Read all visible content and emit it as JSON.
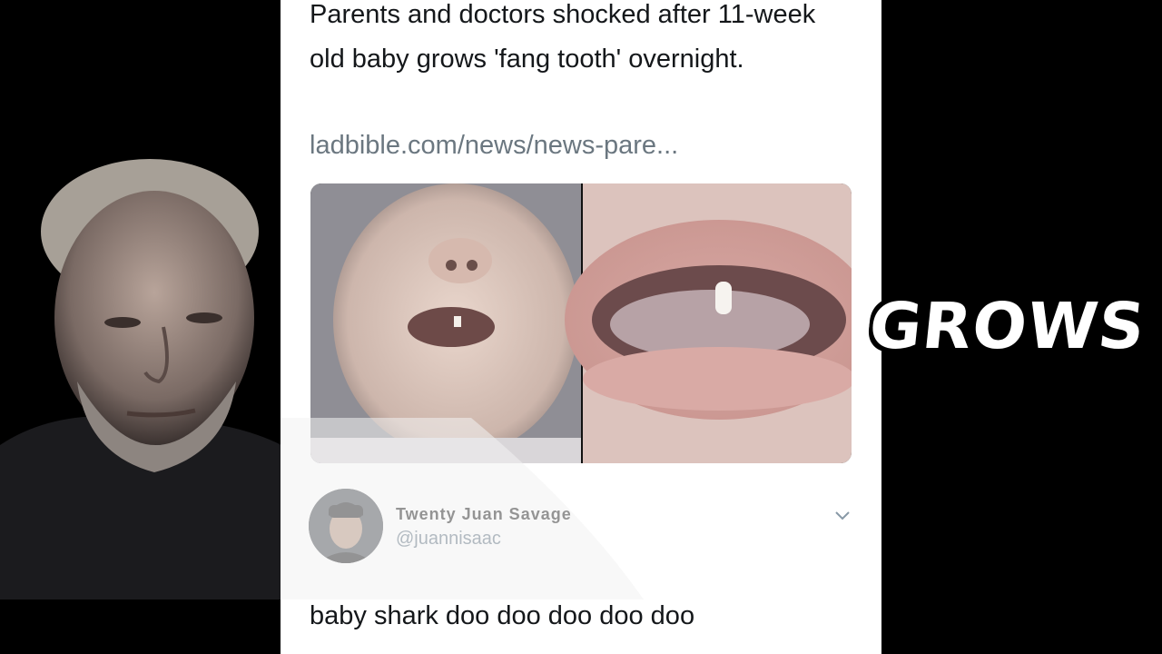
{
  "tweet": {
    "headline": "Parents and doctors shocked after 11-week old baby grows 'fang tooth' overnight.",
    "link": "ladbible.com/news/news-pare..."
  },
  "reply": {
    "display_name": "Twenty Juan Savage",
    "handle": "@juannisaac",
    "text": "baby shark doo doo doo doo doo"
  },
  "overlay": {
    "word": "GROWS"
  }
}
